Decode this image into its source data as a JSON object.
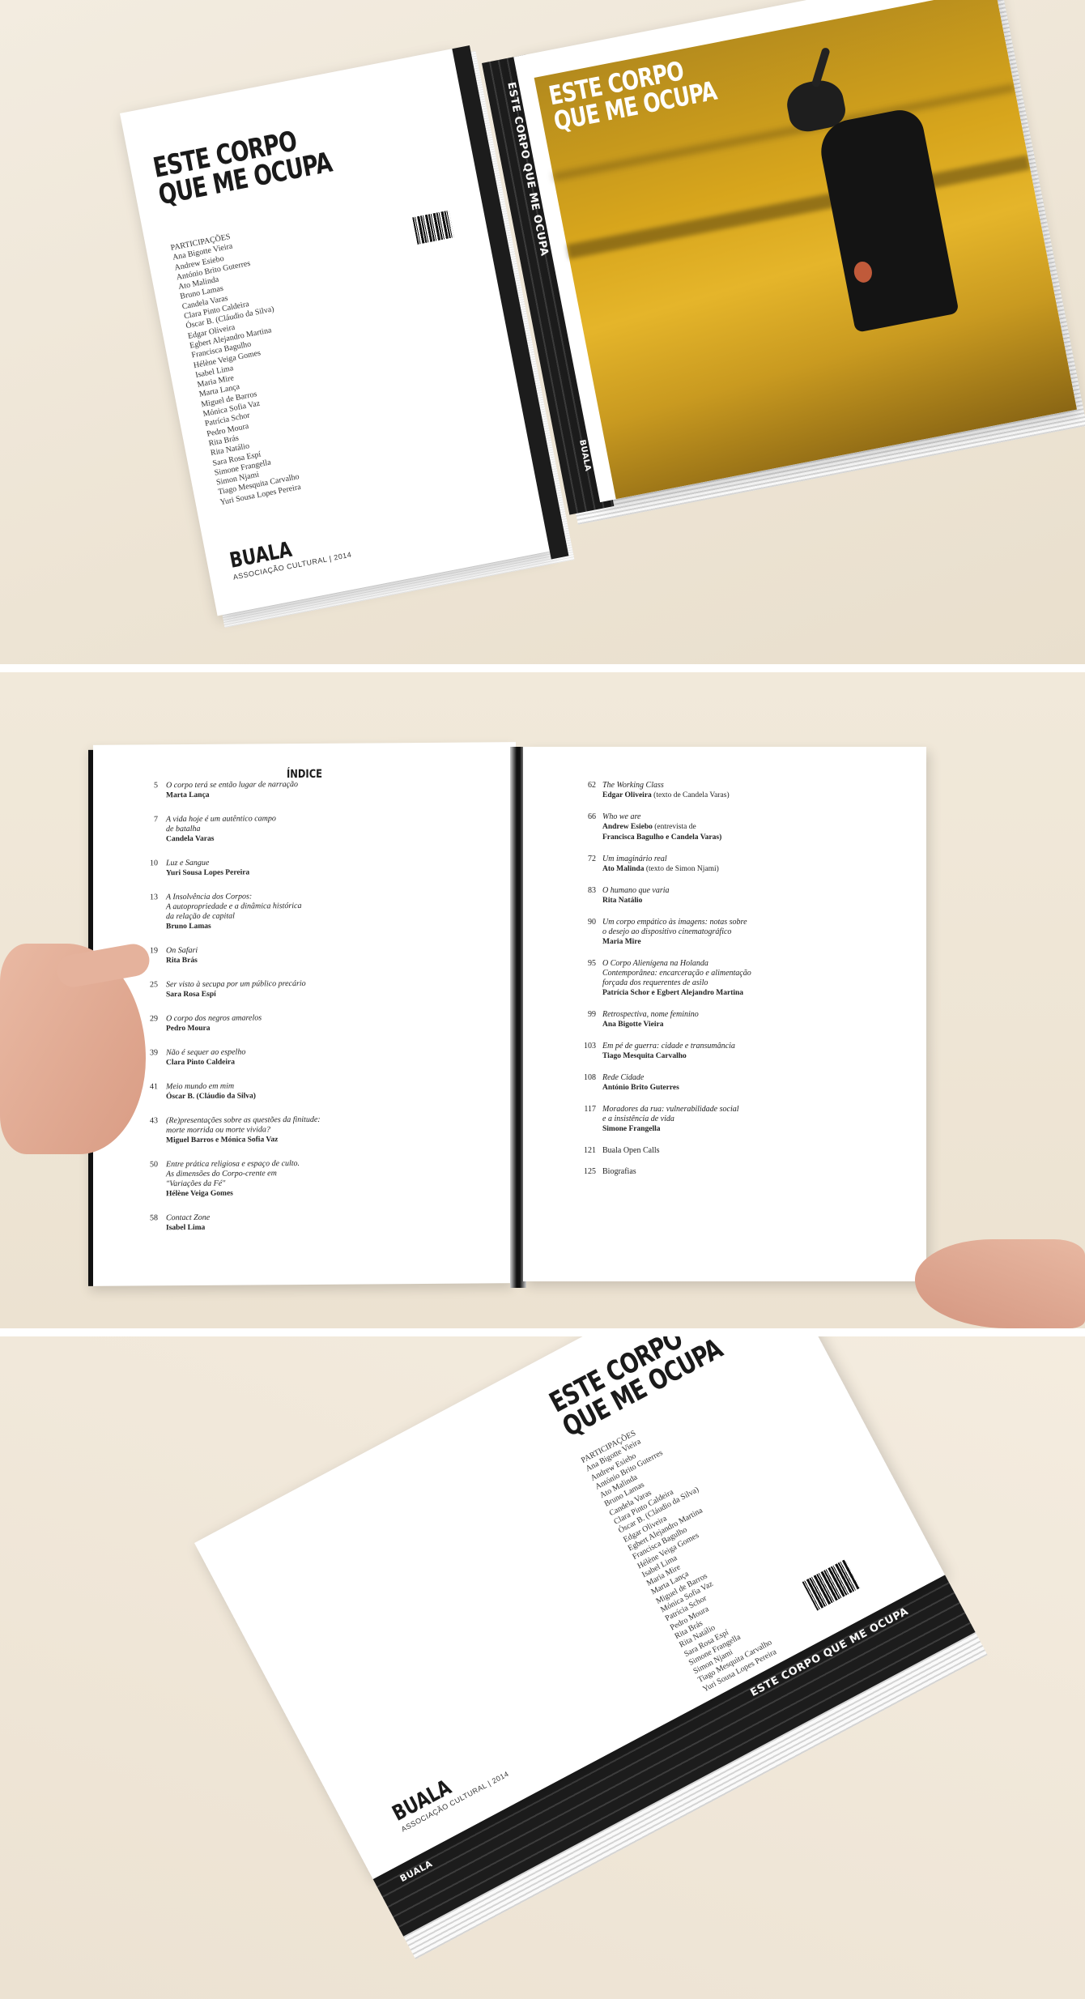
{
  "book": {
    "title_line1": "ESTE CORPO",
    "title_line2": "QUE ME OCUPA",
    "publisher": "BUALA",
    "publisher_sub": "ASSOCIAÇÃO CULTURAL | 2014",
    "spine_label": "BUALA",
    "spine_title": "ESTE CORPO QUE ME OCUPA",
    "participants_heading": "PARTICIPAÇÕES",
    "participants": [
      "Ana Bigotte Vieira",
      "Andrew Esiebo",
      "António Brito Guterres",
      "Ato Malinda",
      "Bruno Lamas",
      "Candela Varas",
      "Clara Pinto Caldeira",
      "Óscar B. (Cláudio da Silva)",
      "Edgar Oliveira",
      "Egbert Alejandro Martina",
      "Francisca Bagulho",
      "Hélène Veiga Gomes",
      "Isabel Lima",
      "Maria Mire",
      "Marta Lança",
      "Miguel de Barros",
      "Mónica Sofia Vaz",
      "Patrícia Schor",
      "Pedro Moura",
      "Rita Brás",
      "Rita Natálio",
      "Sara Rosa Espí",
      "Simone Frangella",
      "Simon Njami",
      "Tiago Mesquita Carvalho",
      "Yuri Sousa Lopes Pereira"
    ]
  },
  "index": {
    "heading": "ÍNDICE",
    "left": [
      {
        "num": "5",
        "title": "O corpo terá se então lugar de narração",
        "author": "Marta Lança"
      },
      {
        "num": "7",
        "title": "A vida hoje é um autêntico campo\nde batalha",
        "author": "Candela Varas"
      },
      {
        "num": "10",
        "title": "Luz e Sangue",
        "author": "Yuri Sousa Lopes Pereira"
      },
      {
        "num": "13",
        "title": "A Insolvência dos Corpos:\nA autopropriedade e a dinâmica histórica\nda relação de capital",
        "author": "Bruno Lamas"
      },
      {
        "num": "19",
        "title": "On Safari",
        "author": "Rita Brás"
      },
      {
        "num": "25",
        "title": "Ser visto à secupa por um público precário",
        "author": "Sara Rosa Espí"
      },
      {
        "num": "29",
        "title": "O corpo dos negros amarelos",
        "author": "Pedro Moura"
      },
      {
        "num": "39",
        "title": "Não é sequer ao espelho",
        "author": "Clara Pinto Caldeira"
      },
      {
        "num": "41",
        "title": "Meio mundo em mim",
        "author": "Óscar B. (Cláudio da Silva)"
      },
      {
        "num": "43",
        "title": "(Re)presentações sobre as questões da finitude:\nmorte morrida ou morte vivida?",
        "author": "Miguel Barros e Mónica Sofia Vaz"
      },
      {
        "num": "50",
        "title": "Entre prática religiosa e espaço de culto.\nAs dimensões do Corpo-crente em\n\"Variações da Fé\"",
        "author": "Hélène Veiga Gomes"
      },
      {
        "num": "58",
        "title": "Contact Zone",
        "author": "Isabel Lima"
      }
    ],
    "right": [
      {
        "num": "62",
        "title": "The Working Class",
        "author": "Edgar Oliveira",
        "note": "(texto de Candela Varas)"
      },
      {
        "num": "66",
        "title": "Who we are",
        "author": "Andrew Esiebo",
        "note": "(entrevista de",
        "author2": "Francisca Bagulho e Candela Varas)"
      },
      {
        "num": "72",
        "title": "Um imaginário real",
        "author": "Ato Malinda",
        "note": "(texto de Simon Njami)"
      },
      {
        "num": "83",
        "title": "O humano que varia",
        "author": "Rita Natálio"
      },
      {
        "num": "90",
        "title": "Um corpo empático às imagens: notas sobre\no desejo ao dispositivo cinematográfico",
        "author": "Maria Mire"
      },
      {
        "num": "95",
        "title": "O Corpo Alienígena na Holanda\nContemporânea: encarceração e alimentação\nforçada dos requerentes de asilo",
        "author": "Patrícia Schor e Egbert Alejandro Martina"
      },
      {
        "num": "99",
        "title": "Retrospectiva, nome feminino",
        "author": "Ana Bigotte Vieira"
      },
      {
        "num": "103",
        "title": "Em pé de guerra: cidade e transumância",
        "author": "Tiago Mesquita Carvalho"
      },
      {
        "num": "108",
        "title": "Rede Cidade",
        "author": "António Brito Guterres"
      },
      {
        "num": "117",
        "title": "Moradores da rua: vulnerabilidade social\ne a insistência de vida",
        "author": "Simone Frangella"
      },
      {
        "num": "121",
        "title": "Buala Open Calls",
        "author": ""
      },
      {
        "num": "125",
        "title": "Biografias",
        "author": ""
      }
    ]
  },
  "colors": {
    "spine": "#1c1c1c",
    "cover_photo_yellow": "#d9a21a",
    "background": "#efe6d6"
  }
}
